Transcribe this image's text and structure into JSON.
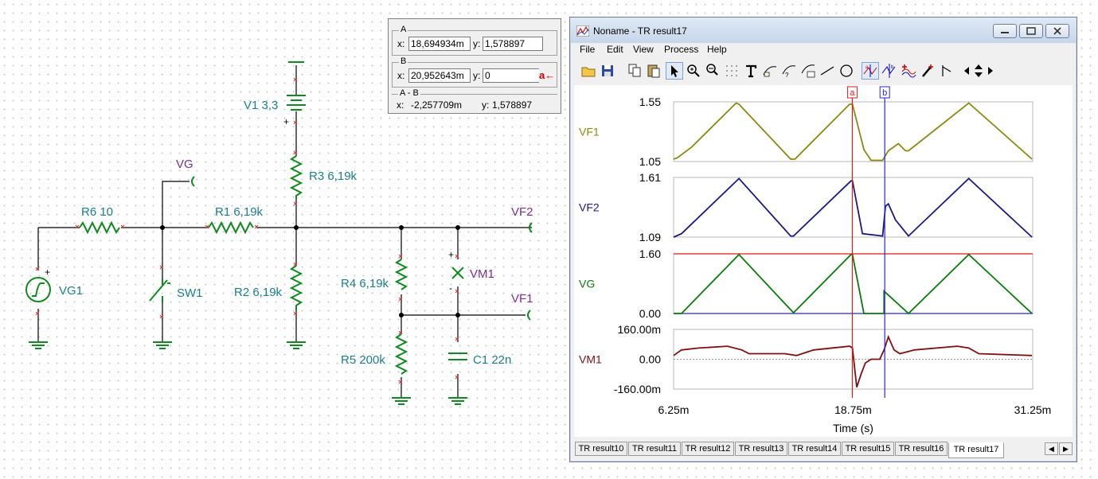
{
  "schematic": {
    "components": {
      "vg1": "VG1",
      "r6": "R6 10",
      "sw1": "SW1",
      "r1": "R1 6,19k",
      "r2": "R2 6,19k",
      "r3": "R3 6,19k",
      "v1": "V1 3,3",
      "r4": "R4 6,19k",
      "r5": "R5 200k",
      "vm1": "VM1",
      "c1": "C1 22n"
    },
    "probes": {
      "vg": "VG",
      "vf2": "VF2",
      "vf1": "VF1"
    },
    "polarity": {
      "plus": "+",
      "minus": "-"
    }
  },
  "cursor_box": {
    "a": {
      "title": "A",
      "x_label": "x:",
      "x_value": "18,694934m",
      "y_label": "y:",
      "y_value": "1,578897"
    },
    "b": {
      "title": "B",
      "x_label": "x:",
      "x_value": "20,952643m",
      "y_label": "y:",
      "y_value": "0",
      "button": "a"
    },
    "diff": {
      "title": "A - B",
      "x_label": "x:",
      "x_value": "-2,257709m",
      "y_label": "y:",
      "y_value": "1,578897"
    }
  },
  "window": {
    "title": "Noname - TR result17",
    "menu": [
      "File",
      "Edit",
      "View",
      "Process",
      "Help"
    ],
    "tabs": [
      "TR result10",
      "TR result11",
      "TR result12",
      "TR result13",
      "TR result14",
      "TR result15",
      "TR result16",
      "TR result17"
    ],
    "active_tab": "TR result17"
  },
  "chart_data": {
    "type": "line",
    "xlabel": "Time (s)",
    "x_ticks": [
      "6.25m",
      "18.75m",
      "31.25m"
    ],
    "xlim": [
      0.00625,
      0.03125
    ],
    "cursors": [
      {
        "name": "a",
        "x": 0.01869,
        "color": "#e81818"
      },
      {
        "name": "b",
        "x": 0.02095,
        "color": "#2828c8"
      }
    ],
    "panels": [
      {
        "name": "VF1",
        "color": "#8a8a10",
        "ylim": [
          1.05,
          1.55
        ],
        "y_ticks": [
          "1.55",
          "1.05"
        ],
        "x": [
          0.00625,
          0.0065,
          0.0075,
          0.0106,
          0.0108,
          0.0144,
          0.0147,
          0.0185,
          0.0187,
          0.0195,
          0.02,
          0.0208,
          0.0212,
          0.0219,
          0.0224,
          0.0226,
          0.0268,
          0.0312
        ],
        "y": [
          1.07,
          1.08,
          1.17,
          1.54,
          1.53,
          1.07,
          1.07,
          1.53,
          1.53,
          1.15,
          1.06,
          1.06,
          1.14,
          1.2,
          1.14,
          1.14,
          1.54,
          1.07
        ]
      },
      {
        "name": "VF2",
        "color": "#1a1a80",
        "ylim": [
          1.09,
          1.61
        ],
        "y_ticks": [
          "1.61",
          "1.09"
        ],
        "x": [
          0.00625,
          0.0068,
          0.0108,
          0.0144,
          0.0146,
          0.0186,
          0.0187,
          0.0194,
          0.0208,
          0.021,
          0.0212,
          0.0217,
          0.0226,
          0.0268,
          0.0312
        ],
        "y": [
          1.09,
          1.12,
          1.6,
          1.1,
          1.1,
          1.58,
          1.58,
          1.12,
          1.1,
          1.36,
          1.38,
          1.24,
          1.1,
          1.6,
          1.09
        ]
      },
      {
        "name": "VG",
        "color": "#0a7a0a",
        "ylim": [
          0.0,
          1.6
        ],
        "y_ticks": [
          "1.60",
          "0.00"
        ],
        "x": [
          0.00625,
          0.0068,
          0.0108,
          0.0146,
          0.0186,
          0.0187,
          0.0195,
          0.0209,
          0.0209,
          0.0226,
          0.0268,
          0.0312
        ],
        "y": [
          0.0,
          0.0,
          1.58,
          0.02,
          1.58,
          1.58,
          0.0,
          0.0,
          0.6,
          0.0,
          1.58,
          0.0
        ],
        "ref_line": {
          "y": 1.6,
          "color": "#e81818"
        },
        "base_line": {
          "y": 0.0,
          "color": "#2828c8"
        }
      },
      {
        "name": "VM1",
        "color": "#801010",
        "ylim": [
          -0.16,
          0.16
        ],
        "y_ticks": [
          "160.00m",
          "0.00",
          "-160.00m"
        ],
        "x": [
          0.00625,
          0.0068,
          0.008,
          0.01,
          0.011,
          0.0115,
          0.014,
          0.0148,
          0.016,
          0.0185,
          0.0187,
          0.019,
          0.0193,
          0.0196,
          0.02,
          0.0206,
          0.0209,
          0.0212,
          0.0216,
          0.022,
          0.023,
          0.026,
          0.0268,
          0.0275,
          0.0312
        ],
        "y": [
          0.02,
          0.05,
          0.06,
          0.07,
          0.05,
          0.03,
          0.03,
          0.02,
          0.05,
          0.07,
          0.06,
          -0.15,
          -0.08,
          -0.02,
          0.0,
          0.0,
          0.05,
          0.12,
          0.05,
          0.03,
          0.05,
          0.07,
          0.06,
          0.03,
          0.02
        ]
      }
    ]
  }
}
